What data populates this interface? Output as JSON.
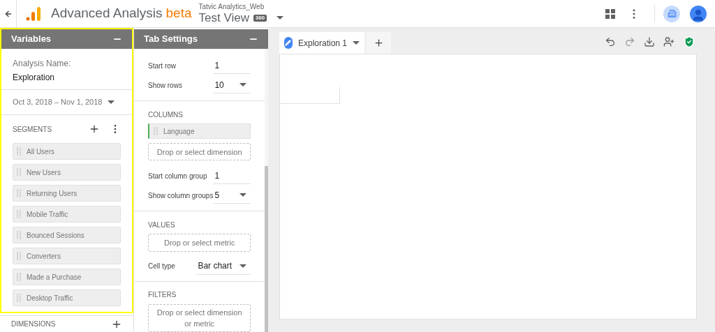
{
  "header": {
    "app_name": "Advanced Analysis",
    "badge": "beta",
    "account": "Tatvic Analytics_Web",
    "view": "Test View",
    "view_badge": "360"
  },
  "variables_panel": {
    "title": "Variables",
    "highlighted": true,
    "analysis_name_label": "Analysis Name:",
    "analysis_name": "Exploration",
    "date_range": "Oct 3, 2018 – Nov 1, 2018",
    "segments_title": "SEGMENTS",
    "segments": [
      "All Users",
      "New Users",
      "Returning Users",
      "Mobile Traffic",
      "Bounced Sessions",
      "Converters",
      "Made a Purchase",
      "Desktop Traffic"
    ],
    "dimensions_title": "DIMENSIONS"
  },
  "tab_settings": {
    "title": "Tab Settings",
    "rows": [
      {
        "kind": "text",
        "label": "Start row",
        "value": "1"
      },
      {
        "kind": "select",
        "label": "Show rows",
        "value": "10"
      }
    ],
    "columns_title": "COLUMNS",
    "columns": [
      "Language"
    ],
    "columns_drop": "Drop or select dimension",
    "column_rows": [
      {
        "kind": "text",
        "label": "Start column group",
        "value": "1"
      },
      {
        "kind": "select",
        "label": "Show column groups",
        "value": "5"
      }
    ],
    "values_title": "VALUES",
    "values_drop": "Drop or select metric",
    "cell_type": {
      "kind": "select",
      "label": "Cell type",
      "value": "Bar chart"
    },
    "filters_title": "FILTERS",
    "filters_drop": "Drop or select dimension or metric"
  },
  "tabs": [
    {
      "label": "Exploration 1",
      "selected": true
    }
  ]
}
